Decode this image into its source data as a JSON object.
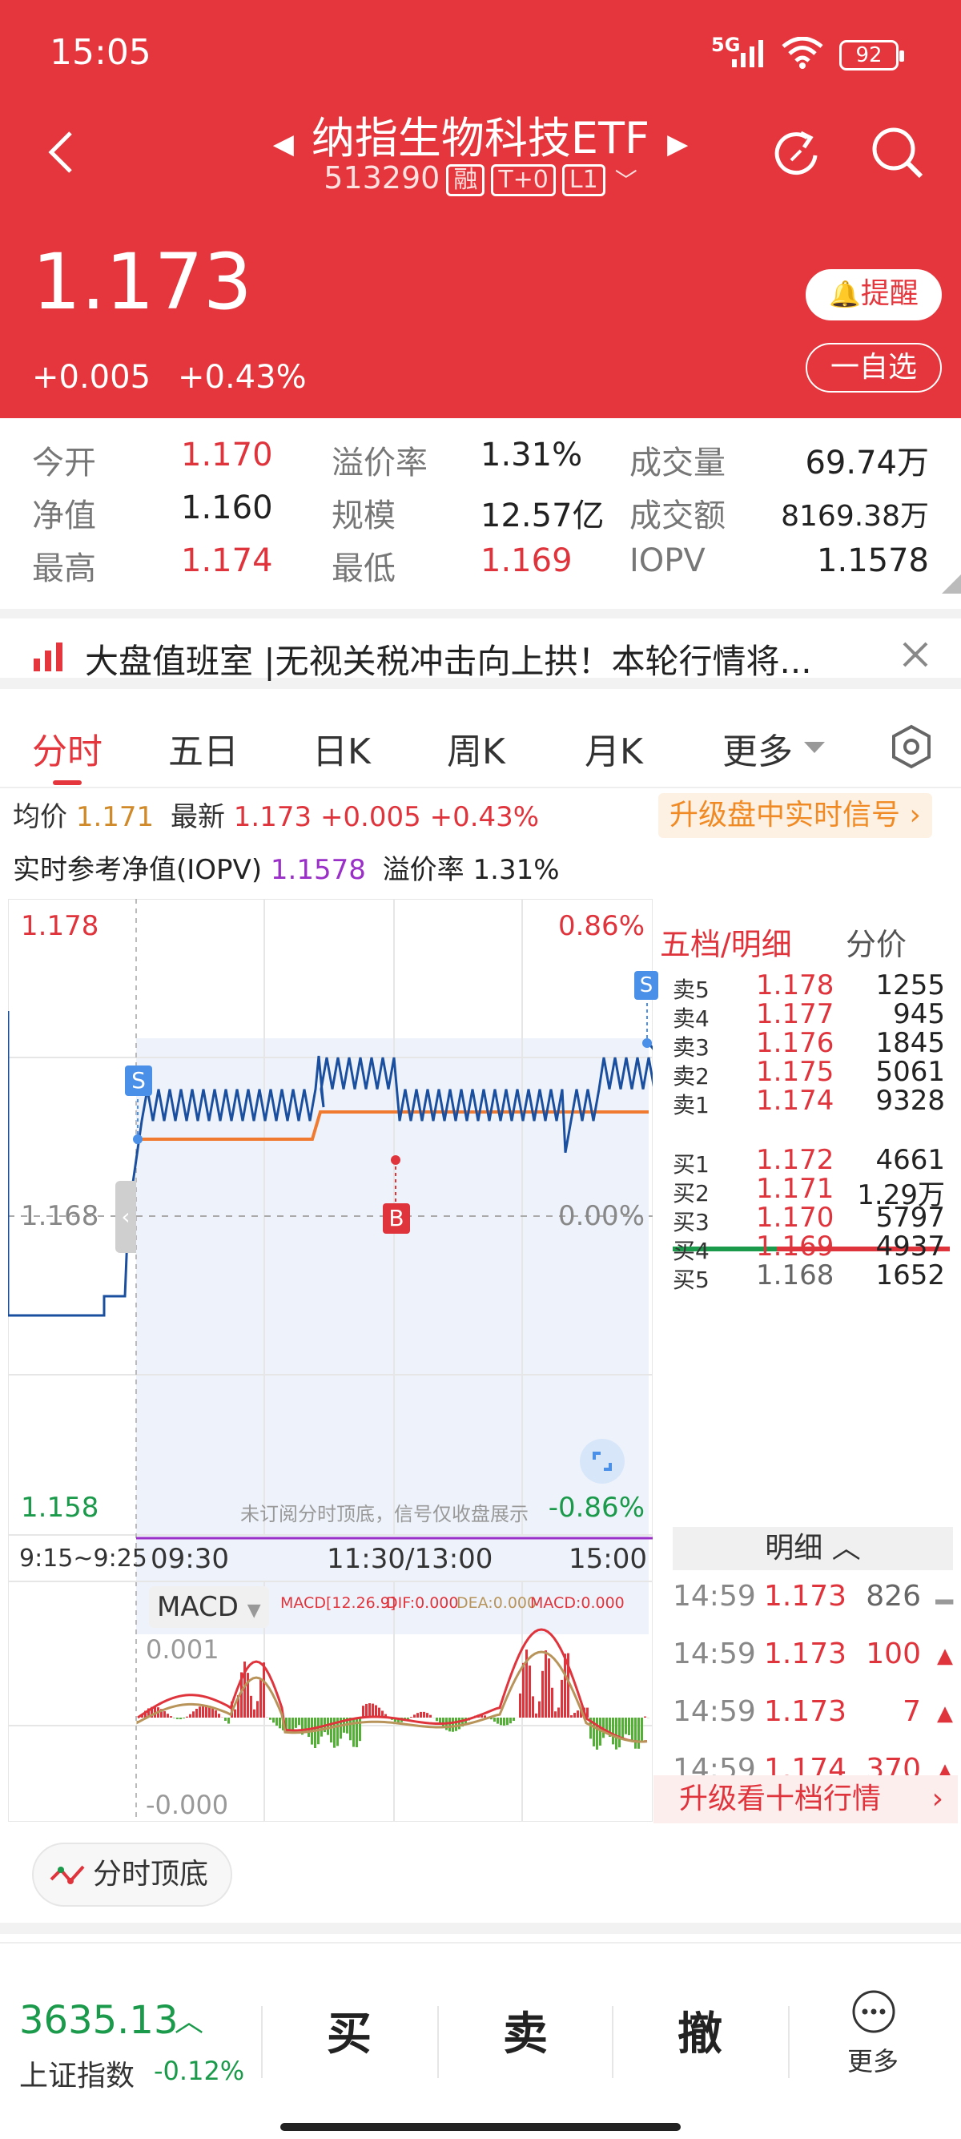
{
  "status": {
    "time": "15:05",
    "network": "5G",
    "battery": "92"
  },
  "header": {
    "title": "纳指生物科技ETF",
    "code": "513290",
    "tags": [
      "融",
      "T+0",
      "L1"
    ],
    "price": "1.173",
    "change": "+0.005",
    "change_pct": "+0.43%",
    "alert_label": "提醒",
    "watch_label": "一自选"
  },
  "stats": {
    "open_label": "今开",
    "open": "1.170",
    "premium_label": "溢价率",
    "premium": "1.31%",
    "volume_label": "成交量",
    "volume": "69.74万",
    "nav_label": "净值",
    "nav": "1.160",
    "scale_label": "规模",
    "scale": "12.57亿",
    "amount_label": "成交额",
    "amount": "8169.38万",
    "high_label": "最高",
    "high": "1.174",
    "low_label": "最低",
    "low": "1.169",
    "iopv_label": "IOPV",
    "iopv": "1.1578"
  },
  "news": {
    "text": "大盘值班室 |无视关税冲击向上拱！本轮行情将..."
  },
  "tabs": [
    "分时",
    "五日",
    "日K",
    "周K",
    "月K",
    "更多"
  ],
  "info": {
    "avg_label": "均价",
    "avg": "1.171",
    "latest_label": "最新",
    "latest": "1.173",
    "change": "+0.005",
    "change_pct": "+0.43%",
    "upgrade": "升级盘中实时信号",
    "iopv_label": "实时参考净值(IOPV)",
    "iopv": "1.1578",
    "premium_label": "溢价率",
    "premium": "1.31%"
  },
  "chart": {
    "y_max": "1.178",
    "y_mid": "1.168",
    "y_min": "1.158",
    "pct_max": "0.86%",
    "pct_mid": "0.00%",
    "pct_min": "-0.86%",
    "notice": "未订阅分时顶底，信号仅收盘展示",
    "times": [
      "9:15~9:25",
      "09:30",
      "11:30/13:00",
      "15:00"
    ],
    "signal_s": "S",
    "signal_b": "B",
    "macd_label": "MACD",
    "macd_params": "MACD[12.26.9]",
    "dif": "DIF:0.000",
    "dea": "DEA:0.000",
    "macd_val": "MACD:0.000",
    "macd_top": "0.001",
    "macd_bottom": "-0.000",
    "topbottom_btn": "分时顶底"
  },
  "orderbook": {
    "tab1": "五档/明细",
    "tab2": "分价",
    "asks": [
      {
        "label": "卖5",
        "price": "1.178",
        "vol": "1255"
      },
      {
        "label": "卖4",
        "price": "1.177",
        "vol": "945"
      },
      {
        "label": "卖3",
        "price": "1.176",
        "vol": "1845"
      },
      {
        "label": "卖2",
        "price": "1.175",
        "vol": "5061"
      },
      {
        "label": "卖1",
        "price": "1.174",
        "vol": "9328"
      }
    ],
    "bids": [
      {
        "label": "买1",
        "price": "1.172",
        "vol": "4661"
      },
      {
        "label": "买2",
        "price": "1.171",
        "vol": "1.29万"
      },
      {
        "label": "买3",
        "price": "1.170",
        "vol": "5797"
      },
      {
        "label": "买4",
        "price": "1.169",
        "vol": "4937"
      },
      {
        "label": "买5",
        "price": "1.168",
        "vol": "1652"
      }
    ],
    "detail_label": "明细",
    "trades": [
      {
        "time": "14:59",
        "price": "1.173",
        "vol": "826"
      },
      {
        "time": "14:59",
        "price": "1.173",
        "vol": "100"
      },
      {
        "time": "14:59",
        "price": "1.173",
        "vol": "7"
      },
      {
        "time": "14:59",
        "price": "1.174",
        "vol": "370"
      }
    ],
    "upgrade": "升级看十档行情"
  },
  "bottom": {
    "index_value": "3635.13",
    "index_name": "上证指数",
    "index_change": "-0.12%",
    "buy": "买",
    "sell": "卖",
    "cancel": "撤",
    "more": "更多"
  }
}
